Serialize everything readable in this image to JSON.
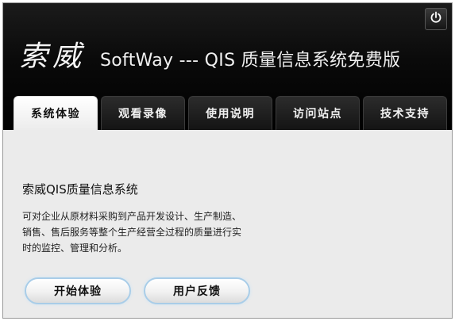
{
  "header": {
    "brand_cn": "索威",
    "brand_subtitle": "SoftWay --- QIS 质量信息系统免费版"
  },
  "tabs": [
    {
      "label": "系统体验",
      "active": true
    },
    {
      "label": "观看录像",
      "active": false
    },
    {
      "label": "使用说明",
      "active": false
    },
    {
      "label": "访问站点",
      "active": false
    },
    {
      "label": "技术支持",
      "active": false
    }
  ],
  "main": {
    "title": "索威QIS质量信息系统",
    "description": "可对企业从原材料采购到产品开发设计、生产制造、销售、售后服务等整个生产经营全过程的质量进行实时的监控、管理和分析。"
  },
  "buttons": {
    "start": "开始体验",
    "feedback": "用户反馈"
  },
  "icons": {
    "power": "power-icon"
  },
  "colors": {
    "header_bg": "#000000",
    "content_bg": "#ebebeb",
    "button_glow": "#a9cde8"
  }
}
